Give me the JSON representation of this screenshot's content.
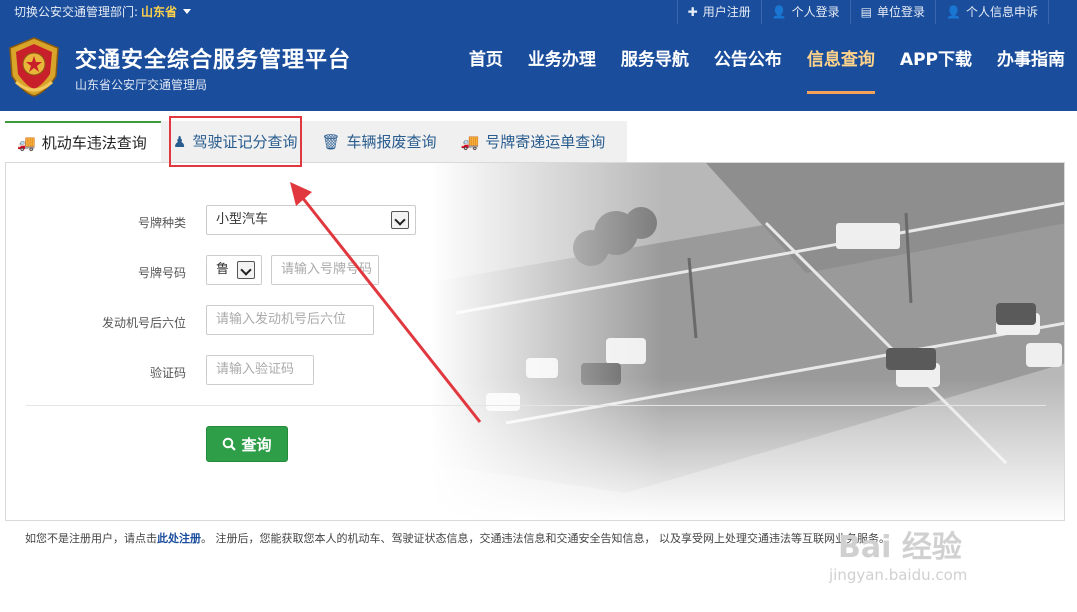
{
  "topbar": {
    "dept_label": "切换公安交通管理部门:",
    "dept_value": "山东省",
    "links": [
      {
        "label": "用户注册",
        "icon": "plus-icon"
      },
      {
        "label": "个人登录",
        "icon": "user-icon"
      },
      {
        "label": "单位登录",
        "icon": "building-icon"
      },
      {
        "label": "个人信息申诉",
        "icon": "user-icon"
      }
    ]
  },
  "header": {
    "title": "交通安全综合服务管理平台",
    "subtitle": "山东省公安厅交通管理局",
    "nav": [
      "首页",
      "业务办理",
      "服务导航",
      "公告公布",
      "信息查询",
      "APP下载",
      "办事指南"
    ],
    "active_nav": "信息查询"
  },
  "tabs": [
    {
      "label": "机动车违法查询",
      "icon": "truck-icon",
      "active": true
    },
    {
      "label": "驾驶证记分查询",
      "icon": "person-icon",
      "active": false
    },
    {
      "label": "车辆报废查询",
      "icon": "trash-icon",
      "active": false
    },
    {
      "label": "号牌寄递运单查询",
      "icon": "truck-icon",
      "active": false
    }
  ],
  "form": {
    "plate_type_label": "号牌种类",
    "plate_type_value": "小型汽车",
    "plate_no_label": "号牌号码",
    "plate_prefix": "鲁",
    "plate_no_placeholder": "请输入号牌号码",
    "engine_label": "发动机号后六位",
    "engine_placeholder": "请输入发动机号后六位",
    "captcha_label": "验证码",
    "captcha_placeholder": "请输入验证码",
    "submit_label": "查询"
  },
  "footer_note": {
    "prefix": "如您不是注册用户，请点击",
    "link": "此处注册",
    "suffix": "。 注册后，您能获取您本人的机动车、驾驶证状态信息，交通违法信息和交通安全告知信息， 以及享受网上处理交通违法等互联网业务服务。"
  },
  "watermark": {
    "text": "Bai 经验",
    "url": "jingyan.baidu.com"
  },
  "colors": {
    "brand": "#1a4d9c",
    "accent": "#ffd48a",
    "button": "#2f9e48",
    "highlight": "#e0383e"
  }
}
